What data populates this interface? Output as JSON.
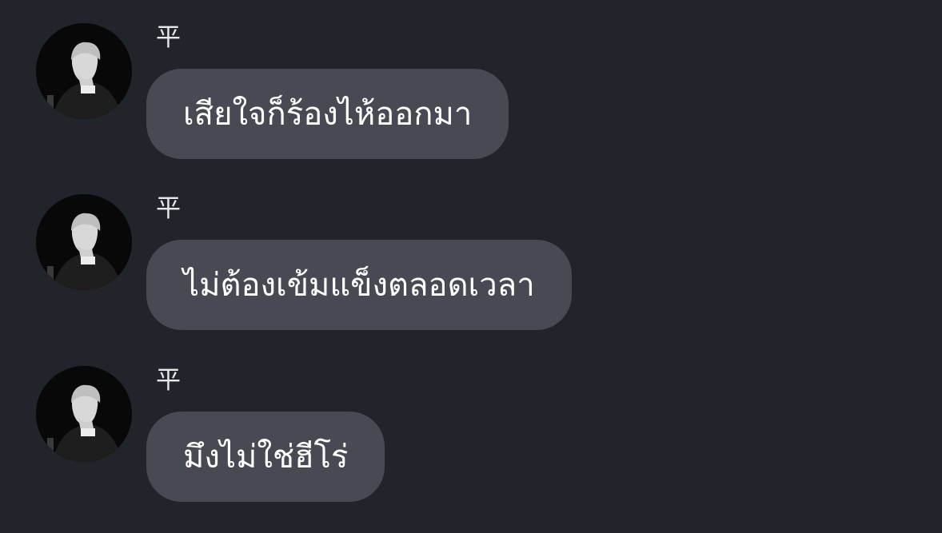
{
  "messages": [
    {
      "sender": "平",
      "text": "เสียใจก็ร้องไห้ออกมา"
    },
    {
      "sender": "平",
      "text": "ไม่ต้องเข้มแข็งตลอดเวลา"
    },
    {
      "sender": "平",
      "text": "มึงไม่ใช่ฮีโร่"
    }
  ],
  "colors": {
    "background": "#22242b",
    "bubble": "#474a52",
    "text": "#ffffff",
    "sender": "#e8e8ea"
  }
}
